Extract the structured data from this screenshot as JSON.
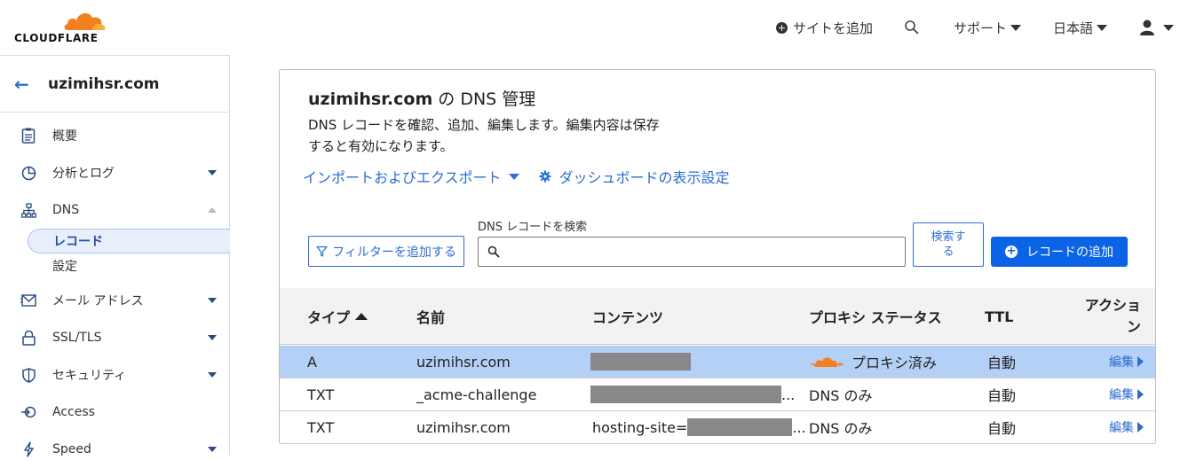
{
  "topbar": {
    "logo_text": "CLOUDFLARE",
    "add_site": "サイトを追加",
    "support": "サポート",
    "language": "日本語"
  },
  "sidebar": {
    "domain": "uzimihsr.com",
    "items": [
      {
        "label": "概要",
        "icon": "document-icon"
      },
      {
        "label": "分析とログ",
        "icon": "pie-chart-icon"
      },
      {
        "label": "DNS",
        "icon": "network-icon"
      },
      {
        "label": "メール アドレス",
        "icon": "mail-icon"
      },
      {
        "label": "SSL/TLS",
        "icon": "lock-icon"
      },
      {
        "label": "セキュリティ",
        "icon": "shield-icon"
      },
      {
        "label": "Access",
        "icon": "access-icon"
      },
      {
        "label": "Speed",
        "icon": "bolt-icon"
      }
    ],
    "dns_sub": [
      "レコード",
      "設定"
    ]
  },
  "card": {
    "title_domain": "uzimihsr.com",
    "title_rest": " の DNS 管理",
    "desc_line1": "DNS レコードを確認、追加、編集します。編集内容は保存",
    "desc_line2": "すると有効になります。",
    "import_export": "インポートおよびエクスポート",
    "dashboard_settings": "ダッシュボードの表示設定",
    "filter_button": "フィルターを追加する",
    "search_label": "DNS レコードを検索",
    "search_placeholder": "",
    "search_button_line1": "検索す",
    "search_button_line2": "る",
    "add_record": "レコードの追加"
  },
  "table": {
    "headers": {
      "type": "タイプ",
      "name": "名前",
      "content": "コンテンツ",
      "proxy": "プロキシ ステータス",
      "ttl": "TTL",
      "action_line1": "アクショ",
      "action_line2": "ン"
    },
    "rows": [
      {
        "type": "A",
        "name": "uzimihsr.com",
        "content_prefix": "",
        "proxy": "プロキシ済み",
        "ttl": "自動",
        "edit": "編集"
      },
      {
        "type": "TXT",
        "name": "_acme-challenge",
        "content_prefix": "",
        "proxy": "DNS のみ",
        "ttl": "自動",
        "edit": "編集"
      },
      {
        "type": "TXT",
        "name": "uzimihsr.com",
        "content_prefix": "hosting-site=",
        "proxy": "DNS のみ",
        "ttl": "自動",
        "edit": "編集"
      }
    ],
    "ellipsis": "..."
  },
  "colors": {
    "accent": "#2c6cd1",
    "primary_button": "#0b63e5",
    "selected_row": "#b5d0f7",
    "cloud_orange": "#f38020"
  }
}
